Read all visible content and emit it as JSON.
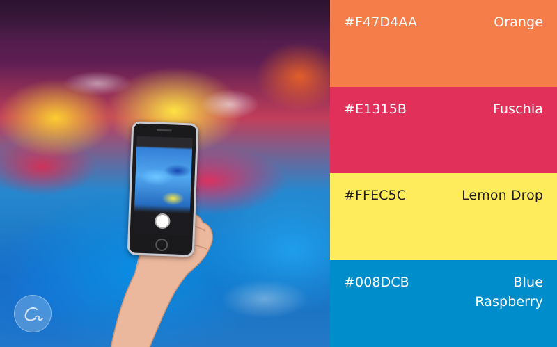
{
  "swatches": [
    {
      "code": "#F47D4AA",
      "name": "Orange",
      "color": "#F47D4A",
      "text_color": "#FFFFFF"
    },
    {
      "code": "#E1315B",
      "name": "Fuschia",
      "color": "#E1315B",
      "text_color": "#FFFFFF"
    },
    {
      "code": "#FFEC5C",
      "name": "Lemon Drop",
      "color": "#FFEC5C",
      "text_color": "#1E1E1E"
    },
    {
      "code": "#008DCB",
      "name": "Blue Raspberry",
      "color": "#008DCB",
      "text_color": "#FFFFFF"
    }
  ],
  "photo": {
    "watermark_text": "Canva"
  }
}
